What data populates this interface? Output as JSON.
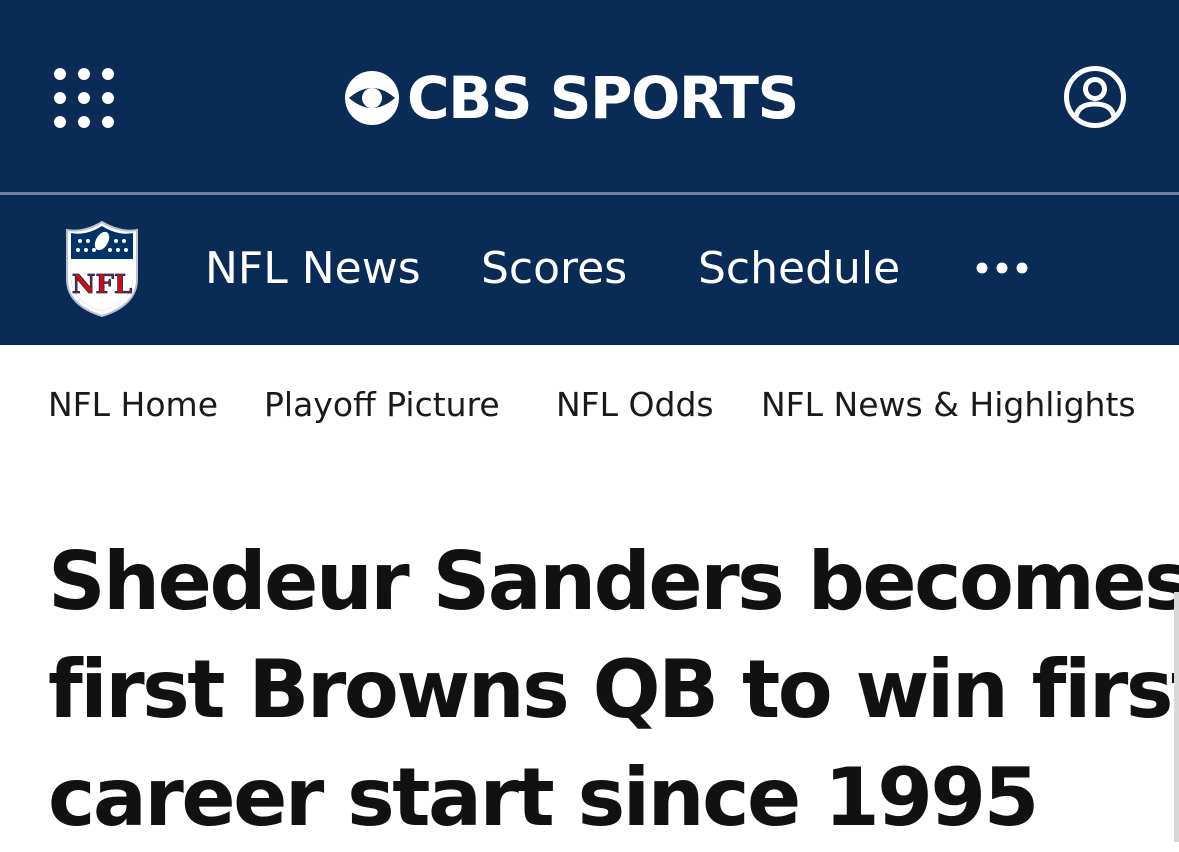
{
  "header": {
    "logo_text": "CBS SPORTS",
    "icons": {
      "menu": "dots-grid-icon",
      "brand": "cbs-eye-icon",
      "account": "user-account-icon"
    }
  },
  "league_nav": {
    "logo_text": "NFL",
    "tabs": [
      {
        "label": "NFL News"
      },
      {
        "label": "Scores"
      },
      {
        "label": "Schedule"
      }
    ],
    "more_icon": "ellipsis-icon"
  },
  "sub_nav": {
    "links": [
      {
        "label": "NFL Home"
      },
      {
        "label": "Playoff Picture"
      },
      {
        "label": "NFL Odds"
      },
      {
        "label": "NFL News & Highlights"
      }
    ]
  },
  "article": {
    "headline_lines": [
      "Shedeur Sanders becomes",
      "first Browns QB to win first",
      "career start since 1995"
    ]
  },
  "colors": {
    "header_bg": "#0b2b57",
    "divider": "#6b819f",
    "nfl_red": "#d50a0a",
    "nfl_blue": "#013369",
    "text_dark": "#111111"
  }
}
